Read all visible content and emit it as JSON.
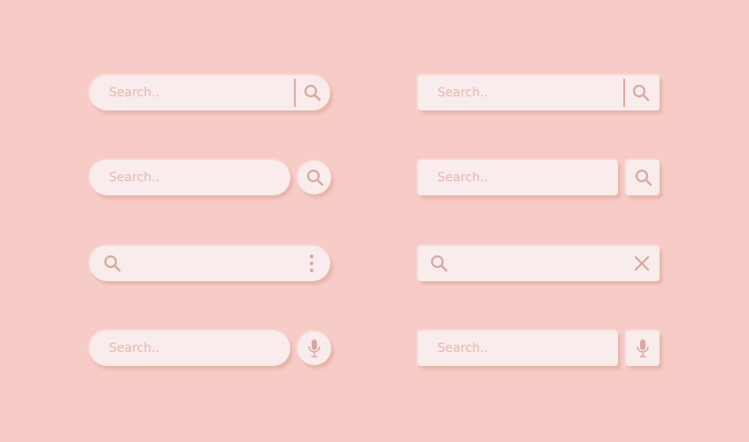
{
  "colors": {
    "background": "#F7CCC6",
    "bar": "#F9ECEC",
    "placeholder": "#E3B8B1",
    "icon": "#D9A79F"
  },
  "bars": [
    {
      "placeholder": "Search..",
      "icon": "search-icon"
    },
    {
      "placeholder": "Search..",
      "icon": "search-icon"
    },
    {
      "placeholder": "",
      "icons": [
        "search-icon",
        "more-vertical-icon"
      ]
    },
    {
      "placeholder": "Search..",
      "icon": "microphone-icon"
    },
    {
      "placeholder": "Search..",
      "icon": "search-icon"
    },
    {
      "placeholder": "Search..",
      "icon": "search-icon"
    },
    {
      "placeholder": "",
      "icons": [
        "search-icon",
        "close-icon"
      ]
    },
    {
      "placeholder": "Search..",
      "icon": "microphone-icon"
    }
  ]
}
